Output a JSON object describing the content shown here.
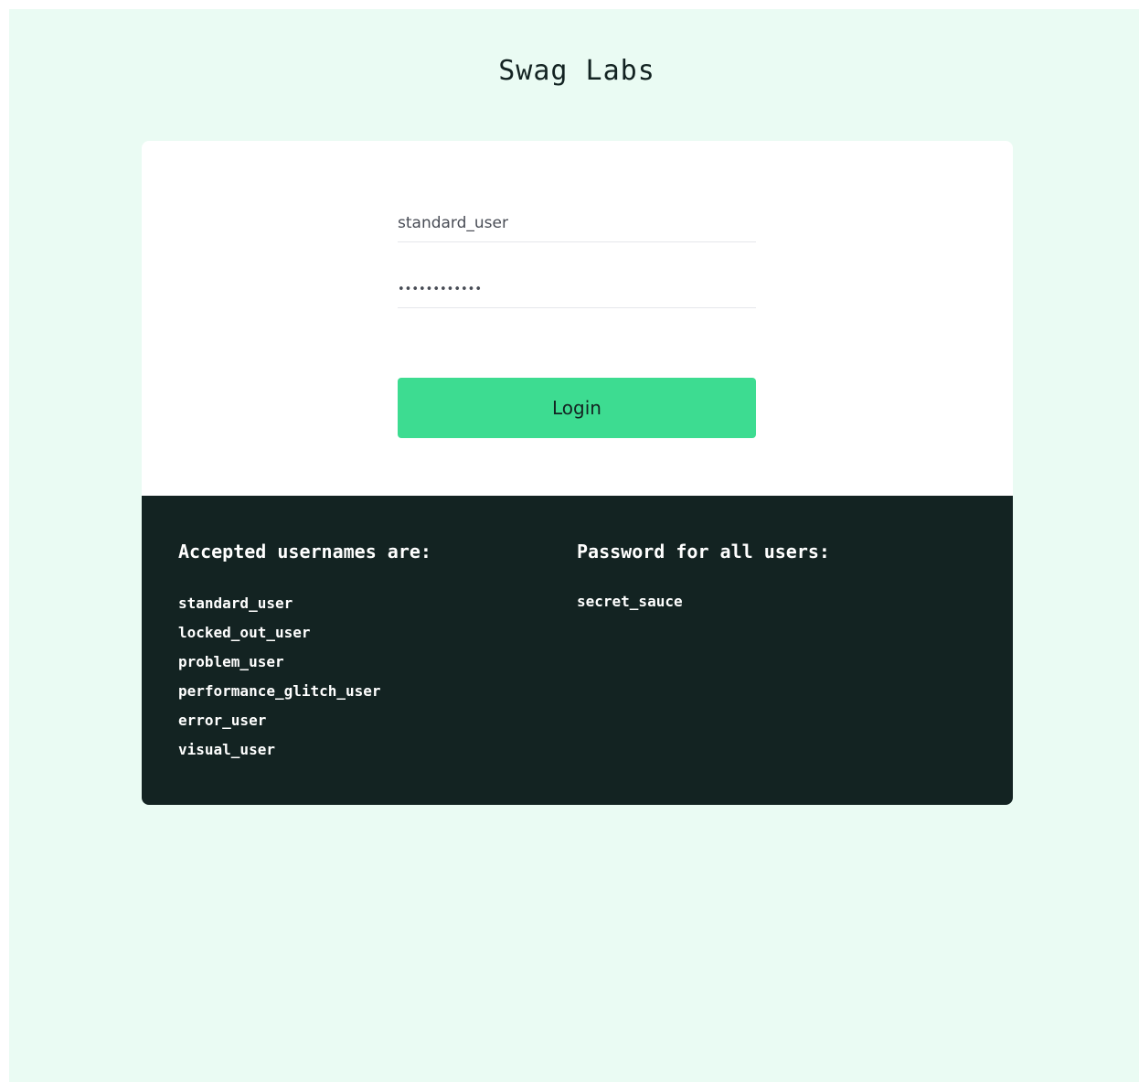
{
  "app": {
    "title": "Swag Labs"
  },
  "login_form": {
    "username_value": "standard_user",
    "password_value": "••••••••••••",
    "login_button_label": "Login"
  },
  "credentials": {
    "usernames_heading": "Accepted usernames are:",
    "usernames": [
      "standard_user",
      "locked_out_user",
      "problem_user",
      "performance_glitch_user",
      "error_user",
      "visual_user"
    ],
    "password_heading": "Password for all users:",
    "password": "secret_sauce"
  },
  "colors": {
    "page_background": "#eafbf3",
    "card_background": "#ffffff",
    "login_button": "#3ddc91",
    "credentials_panel": "#132322"
  }
}
